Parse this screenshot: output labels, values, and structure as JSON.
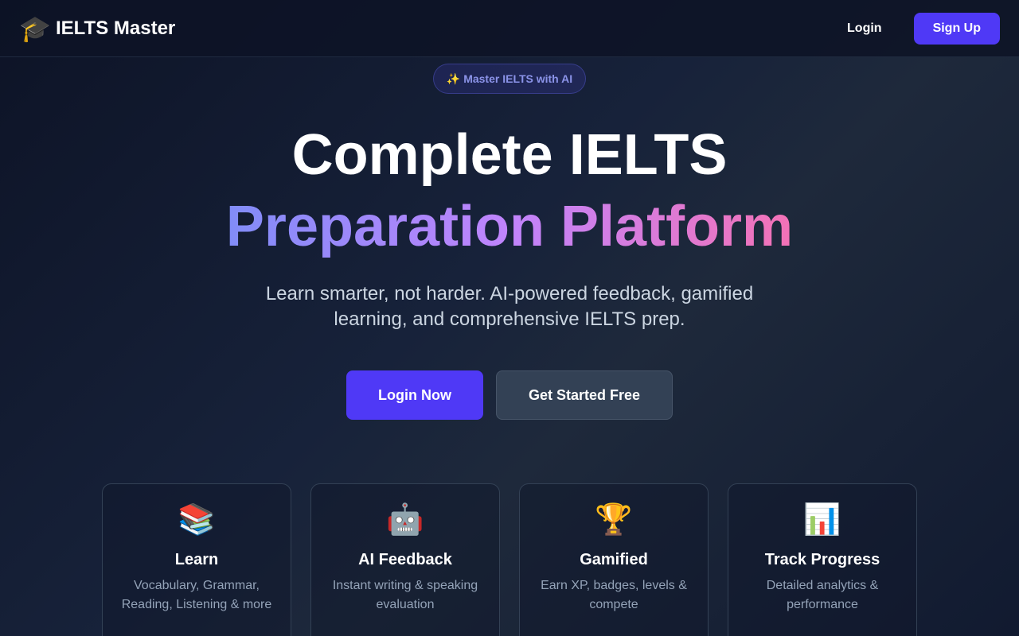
{
  "nav": {
    "brand_icon": "🎓",
    "brand_name": "IELTS Master",
    "login_label": "Login",
    "signup_label": "Sign Up"
  },
  "hero": {
    "badge": "✨ Master IELTS with AI",
    "title_line1": "Complete IELTS",
    "title_line2": "Preparation Platform",
    "subtitle": "Learn smarter, not harder. AI-powered feedback, gamified learning, and comprehensive IELTS prep.",
    "login_now_label": "Login Now",
    "get_started_label": "Get Started Free"
  },
  "features": [
    {
      "icon": "📚",
      "icon_name": "books-icon",
      "title": "Learn",
      "description": "Vocabulary, Grammar, Reading, Listening & more"
    },
    {
      "icon": "🤖",
      "icon_name": "robot-icon",
      "title": "AI Feedback",
      "description": "Instant writing & speaking evaluation"
    },
    {
      "icon": "🏆",
      "icon_name": "trophy-icon",
      "title": "Gamified",
      "description": "Earn XP, badges, levels & compete"
    },
    {
      "icon": "📊",
      "icon_name": "bar-chart-icon",
      "title": "Track Progress",
      "description": "Detailed analytics & performance"
    }
  ],
  "colors": {
    "accent": "#4f39f6",
    "gradient_start": "#818cf8",
    "gradient_mid": "#c084fc",
    "gradient_end": "#f472b6"
  }
}
